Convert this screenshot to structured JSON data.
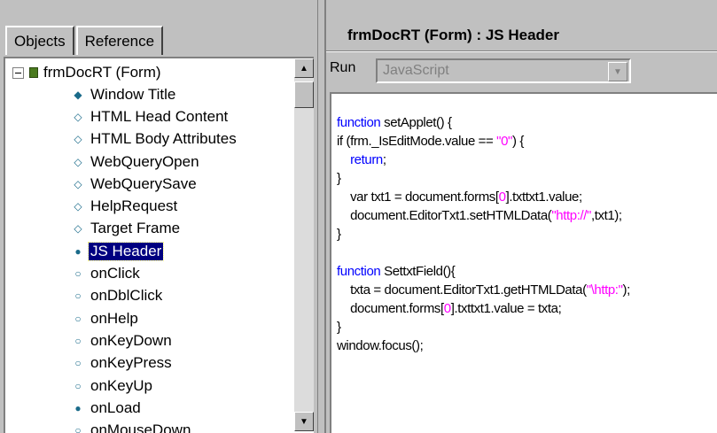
{
  "left_panel": {
    "tabs": [
      {
        "label": "Objects",
        "active": true
      },
      {
        "label": "Reference",
        "active": false
      }
    ],
    "tree": {
      "root_label": "frmDocRT (Form)",
      "items": [
        {
          "label": "Window Title",
          "icon": "filled-diamond-icon",
          "symbol": "◆",
          "selected": false
        },
        {
          "label": "HTML Head Content",
          "icon": "diamond-outline-icon",
          "symbol": "◇",
          "selected": false
        },
        {
          "label": "HTML Body Attributes",
          "icon": "diamond-outline-icon",
          "symbol": "◇",
          "selected": false
        },
        {
          "label": "WebQueryOpen",
          "icon": "diamond-outline-icon",
          "symbol": "◇",
          "selected": false
        },
        {
          "label": "WebQuerySave",
          "icon": "diamond-outline-icon",
          "symbol": "◇",
          "selected": false
        },
        {
          "label": "HelpRequest",
          "icon": "diamond-outline-icon",
          "symbol": "◇",
          "selected": false
        },
        {
          "label": "Target Frame",
          "icon": "diamond-outline-icon",
          "symbol": "◇",
          "selected": false
        },
        {
          "label": "JS Header",
          "icon": "filled-circle-icon",
          "symbol": "●",
          "selected": true
        },
        {
          "label": "onClick",
          "icon": "circle-outline-icon",
          "symbol": "○",
          "selected": false
        },
        {
          "label": "onDblClick",
          "icon": "circle-outline-icon",
          "symbol": "○",
          "selected": false
        },
        {
          "label": "onHelp",
          "icon": "circle-outline-icon",
          "symbol": "○",
          "selected": false
        },
        {
          "label": "onKeyDown",
          "icon": "circle-outline-icon",
          "symbol": "○",
          "selected": false
        },
        {
          "label": "onKeyPress",
          "icon": "circle-outline-icon",
          "symbol": "○",
          "selected": false
        },
        {
          "label": "onKeyUp",
          "icon": "circle-outline-icon",
          "symbol": "○",
          "selected": false
        },
        {
          "label": "onLoad",
          "icon": "filled-circle-icon",
          "symbol": "●",
          "selected": false
        },
        {
          "label": "onMouseDown",
          "icon": "circle-outline-icon",
          "symbol": "○",
          "selected": false
        }
      ]
    }
  },
  "right_panel": {
    "title": "frmDocRT (Form) : JS Header",
    "run_label": "Run",
    "run_value": "JavaScript",
    "code_lines": [
      [
        {
          "t": "function",
          "c": "kw"
        },
        {
          "t": " setApplet() {"
        }
      ],
      [
        {
          "t": "if (frm._IsEditMode.value == "
        },
        {
          "t": "\"0\"",
          "c": "str"
        },
        {
          "t": ") {"
        }
      ],
      [
        {
          "t": "    "
        },
        {
          "t": "return",
          "c": "kw"
        },
        {
          "t": ";"
        }
      ],
      [
        {
          "t": "}"
        }
      ],
      [
        {
          "t": "    var txt1 = document.forms["
        },
        {
          "t": "0",
          "c": "str"
        },
        {
          "t": "].txttxt1.value;"
        }
      ],
      [
        {
          "t": "    document.EditorTxt1.setHTMLData("
        },
        {
          "t": "\"http://\"",
          "c": "str"
        },
        {
          "t": ",txt1);"
        }
      ],
      [
        {
          "t": "}"
        }
      ],
      [
        {
          "t": ""
        }
      ],
      [
        {
          "t": "function",
          "c": "kw"
        },
        {
          "t": " SettxtField(){"
        }
      ],
      [
        {
          "t": "    txta = document.EditorTxt1.getHTMLData("
        },
        {
          "t": "\"\\http:\"",
          "c": "str"
        },
        {
          "t": ");"
        }
      ],
      [
        {
          "t": "    document.forms["
        },
        {
          "t": "0",
          "c": "str"
        },
        {
          "t": "].txttxt1.value = txta;"
        }
      ],
      [
        {
          "t": "}"
        }
      ],
      [
        {
          "t": "window.focus();"
        }
      ]
    ]
  },
  "colors": {
    "keyword": "#0000ff",
    "string": "#ff00ff",
    "selection": "#000080"
  }
}
